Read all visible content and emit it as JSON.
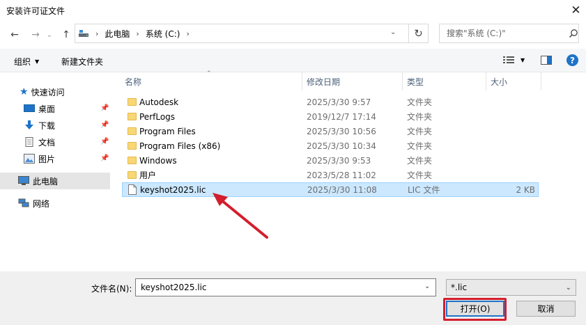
{
  "window": {
    "title": "安装许可证文件",
    "close_glyph": "✕"
  },
  "nav": {
    "back_glyph": "←",
    "forward_glyph": "→",
    "recent_glyph": "⌄",
    "up_glyph": "↑",
    "breadcrumb": [
      "此电脑",
      "系统 (C:)"
    ],
    "search_placeholder": "搜索\"系统 (C:)\""
  },
  "toolbar": {
    "organize_label": "组织",
    "new_folder_label": "新建文件夹",
    "help_glyph": "?"
  },
  "sidebar": {
    "items": [
      {
        "label": "快速访问",
        "icon": "star-icon"
      },
      {
        "label": "桌面",
        "icon": "desktop-icon",
        "pinned": true
      },
      {
        "label": "下载",
        "icon": "download-icon",
        "pinned": true
      },
      {
        "label": "文档",
        "icon": "document-icon",
        "pinned": true
      },
      {
        "label": "图片",
        "icon": "picture-icon",
        "pinned": true
      },
      {
        "label": "此电脑",
        "icon": "computer-icon",
        "selected": true
      },
      {
        "label": "网络",
        "icon": "network-icon"
      }
    ]
  },
  "columns": {
    "name": "名称",
    "modified": "修改日期",
    "type": "类型",
    "size": "大小"
  },
  "files": [
    {
      "name": "Autodesk",
      "modified": "2025/3/30 9:57",
      "type": "文件夹",
      "size": "",
      "kind": "folder"
    },
    {
      "name": "PerfLogs",
      "modified": "2019/12/7 17:14",
      "type": "文件夹",
      "size": "",
      "kind": "folder"
    },
    {
      "name": "Program Files",
      "modified": "2025/3/30 10:56",
      "type": "文件夹",
      "size": "",
      "kind": "folder"
    },
    {
      "name": "Program Files (x86)",
      "modified": "2025/3/30 10:34",
      "type": "文件夹",
      "size": "",
      "kind": "folder"
    },
    {
      "name": "Windows",
      "modified": "2025/3/30 9:53",
      "type": "文件夹",
      "size": "",
      "kind": "folder"
    },
    {
      "name": "用户",
      "modified": "2023/5/28 11:02",
      "type": "文件夹",
      "size": "",
      "kind": "folder"
    },
    {
      "name": "keyshot2025.lic",
      "modified": "2025/3/30 11:08",
      "type": "LIC 文件",
      "size": "2 KB",
      "kind": "file",
      "selected": true
    }
  ],
  "footer": {
    "filename_label": "文件名(N):",
    "filename_value": "keyshot2025.lic",
    "filter_value": "*.lic",
    "open_label": "打开(O)",
    "cancel_label": "取消"
  },
  "colors": {
    "selection": "#cce8ff",
    "selection_border": "#99d1ff",
    "sidebar_selected": "#e5e5e5",
    "annotation": "#d31e2d",
    "help_blue": "#1e73c9"
  }
}
